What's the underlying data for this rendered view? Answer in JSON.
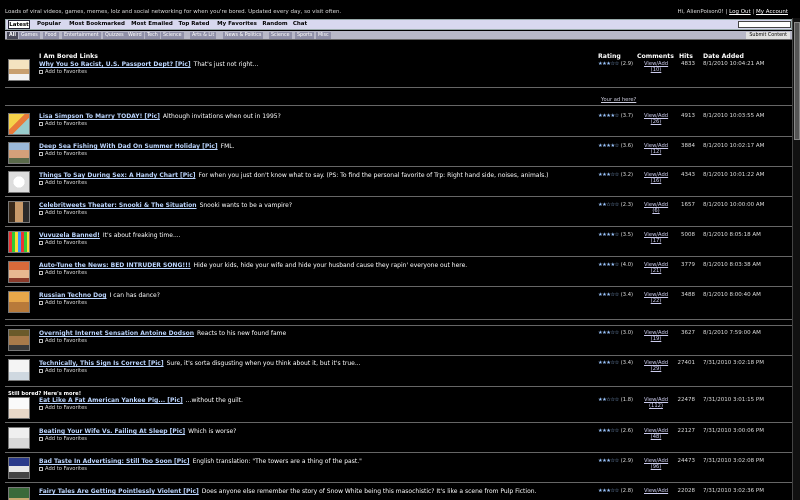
{
  "header": {
    "tagline": "Loads of viral videos, games, memes, lolz and social networking for when you're bored. Updated every day, so visit often.",
    "greeting": "Hi, AlienPoison0!",
    "logout": "Log Out",
    "account": "My Account",
    "separator": "|"
  },
  "nav": {
    "tabs": [
      "Latest",
      "Popular",
      "Most Bookmarked",
      "Most Emailed",
      "Top Rated",
      "My Favorites",
      "Random",
      "Chat"
    ]
  },
  "categories": {
    "items": [
      "All",
      "Games",
      "Food",
      "Entertainment",
      "Quizzes",
      "Weird",
      "Tech",
      "Science",
      "Arts & Lit",
      "News & Politics",
      "Science",
      "Sports",
      "Misc"
    ],
    "submit": "Submit Content"
  },
  "table": {
    "headers": [
      "I Am Bored Links",
      "Rating",
      "Comments",
      "Hits",
      "Date Added"
    ]
  },
  "ad_link": "Your ad here?",
  "section_label": "Still bored? Here's more!",
  "add_to_favorites": "Add to Favorites",
  "rows": [
    {
      "title": "Why You So Racist, U.S. Passport Dept? [Pic]",
      "desc": "That's just not right...",
      "rating": "(2.9)",
      "stars": "★★★☆☆",
      "comment_label": "View/Add",
      "comments": "(10)",
      "hits": "4833",
      "date": "8/1/2010 10:04:21 AM"
    },
    {
      "title": "Lisa Simpson To Marry TODAY! [Pic]",
      "desc": "Although invitations when out in 1995?",
      "rating": "(3.7)",
      "stars": "★★★★☆",
      "comment_label": "View/Add",
      "comments": "(26)",
      "hits": "4913",
      "date": "8/1/2010 10:03:55 AM"
    },
    {
      "title": "Deep Sea Fishing With Dad On Summer Holiday [Pic]",
      "desc": "FML.",
      "rating": "(3.6)",
      "stars": "★★★★☆",
      "comment_label": "View/Add",
      "comments": "(12)",
      "hits": "3884",
      "date": "8/1/2010 10:02:17 AM"
    },
    {
      "title": "Things To Say During Sex: A Handy Chart [Pic]",
      "desc": "For when you just don't know what to say. (PS: To find the personal favorite of Trp: Right hand side, noises, animals.)",
      "rating": "(3.2)",
      "stars": "★★★☆☆",
      "comment_label": "View/Add",
      "comments": "(16)",
      "hits": "4343",
      "date": "8/1/2010 10:01:22 AM"
    },
    {
      "title": "Celebritweets Theater: Snooki & The Situation",
      "desc": "Snooki wants to be a vampire?",
      "rating": "(2.3)",
      "stars": "★★☆☆☆",
      "comment_label": "View/Add",
      "comments": "(6)",
      "hits": "1657",
      "date": "8/1/2010 10:00:00 AM"
    },
    {
      "title": "Vuvuzela Banned!",
      "desc": "It's about freaking time....",
      "rating": "(3.5)",
      "stars": "★★★★☆",
      "comment_label": "View/Add",
      "comments": "(17)",
      "hits": "5008",
      "date": "8/1/2010 8:05:18 AM"
    },
    {
      "title": "Auto-Tune the News: BED INTRUDER SONG!!!",
      "desc": "Hide your kids, hide your wife and hide your husband cause they rapin' everyone out here.",
      "rating": "(4.0)",
      "stars": "★★★★☆",
      "comment_label": "View/Add",
      "comments": "(21)",
      "hits": "3779",
      "date": "8/1/2010 8:03:38 AM"
    },
    {
      "title": "Russian Techno Dog",
      "desc": "I can has dance?",
      "rating": "(3.4)",
      "stars": "★★★☆☆",
      "comment_label": "View/Add",
      "comments": "(22)",
      "hits": "3488",
      "date": "8/1/2010 8:00:40 AM"
    },
    {
      "title": "Overnight Internet Sensation Antoine Dodson",
      "desc": "Reacts to his new found fame",
      "rating": "(3.0)",
      "stars": "★★★☆☆",
      "comment_label": "View/Add",
      "comments": "(19)",
      "hits": "3627",
      "date": "8/1/2010 7:59:00 AM"
    },
    {
      "title": "Technically, This Sign Is Correct [Pic]",
      "desc": "Sure, it's sorta disgusting when you think about it, but it's true...",
      "rating": "(3.4)",
      "stars": "★★★☆☆",
      "comment_label": "View/Add",
      "comments": "(29)",
      "hits": "27401",
      "date": "7/31/2010 3:02:18 PM"
    },
    {
      "title": "Eat Like A Fat American Yankee Pig... [Pic]",
      "desc": "...without the guilt.",
      "rating": "(1.8)",
      "stars": "★★☆☆☆",
      "comment_label": "View/Add",
      "comments": "(112)",
      "hits": "22478",
      "date": "7/31/2010 3:01:15 PM"
    },
    {
      "title": "Beating Your Wife Vs. Failing At Sleep [Pic]",
      "desc": "Which is worse?",
      "rating": "(2.6)",
      "stars": "★★★☆☆",
      "comment_label": "View/Add",
      "comments": "(48)",
      "hits": "22127",
      "date": "7/31/2010 3:00:06 PM"
    },
    {
      "title": "Bad Taste In Advertising: Still Too Soon [Pic]",
      "desc": "English translation: \"The towers are a thing of the past.\"",
      "rating": "(2.9)",
      "stars": "★★★☆☆",
      "comment_label": "View/Add",
      "comments": "(96)",
      "hits": "24473",
      "date": "7/31/2010 3:02:08 PM"
    },
    {
      "title": "Fairy Tales Are Getting Pointlessly Violent [Pic]",
      "desc": "Does anyone else remember the story of Snow White being this masochistic? It's like a scene from Pulp Fiction.",
      "rating": "(2.8)",
      "stars": "★★★☆☆",
      "comment_label": "View/Add",
      "comments": "(46)",
      "hits": "22028",
      "date": "7/31/2010 3:02:36 PM"
    }
  ]
}
